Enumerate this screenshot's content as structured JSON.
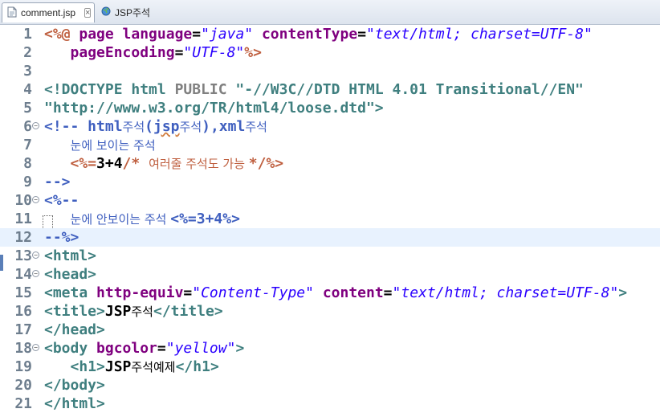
{
  "tabs": [
    {
      "label": "comment.jsp",
      "active": true,
      "icon": "jsp-file-icon"
    },
    {
      "label": "JSP주석",
      "active": false,
      "icon": "globe-icon"
    }
  ],
  "editor": {
    "current_line": 12,
    "lines": [
      {
        "n": "1",
        "tokens": [
          [
            "jsp",
            "<%@ "
          ],
          [
            "at",
            "page "
          ],
          [
            "at",
            "language"
          ],
          [
            "txt",
            "="
          ],
          [
            "str",
            "\"java\""
          ],
          [
            "txt",
            " "
          ],
          [
            "at",
            "contentType"
          ],
          [
            "txt",
            "="
          ],
          [
            "str",
            "\"text/html; charset=UTF-8\""
          ]
        ]
      },
      {
        "n": "2",
        "tokens": [
          [
            "txt",
            "   "
          ],
          [
            "at",
            "pageEncoding"
          ],
          [
            "txt",
            "="
          ],
          [
            "str",
            "\"UTF-8\""
          ],
          [
            "jsp",
            "%>"
          ]
        ]
      },
      {
        "n": "3",
        "tokens": []
      },
      {
        "n": "4",
        "tokens": [
          [
            "kw",
            "<!DOCTYPE html "
          ],
          [
            "gray",
            "PUBLIC "
          ],
          [
            "kw",
            "\"-//W3C//DTD HTML 4.01 Transitional//EN\""
          ]
        ]
      },
      {
        "n": "5",
        "tokens": [
          [
            "kw",
            "\"http://www.w3.org/TR/html4/loose.dtd\">"
          ]
        ]
      },
      {
        "n": "6",
        "fold": true,
        "tokens": [
          [
            "cm",
            "<!-- html"
          ],
          [
            "cmko",
            "주석"
          ],
          [
            "cm",
            "("
          ],
          [
            "cmsq",
            "jsp"
          ],
          [
            "cmko",
            "주석"
          ],
          [
            "cm",
            "),xml"
          ],
          [
            "cmko",
            "주석"
          ]
        ]
      },
      {
        "n": "7",
        "tokens": [
          [
            "cm",
            "   "
          ],
          [
            "cmko",
            "눈에 보이는 주석"
          ]
        ]
      },
      {
        "n": "8",
        "tokens": [
          [
            "txt",
            "   "
          ],
          [
            "jsp",
            "<%="
          ],
          [
            "txt",
            "3+4"
          ],
          [
            "jsp",
            "/* "
          ],
          [
            "jspko",
            "여러줄 주석도 가능 "
          ],
          [
            "jsp",
            "*/%>"
          ]
        ]
      },
      {
        "n": "9",
        "tokens": [
          [
            "cm",
            "-->"
          ]
        ]
      },
      {
        "n": "10",
        "fold": true,
        "tokens": [
          [
            "cm",
            "<%--"
          ]
        ]
      },
      {
        "n": "11",
        "tokens": [
          [
            "cm",
            "   "
          ],
          [
            "cmko",
            "눈에 안보이는 주석 "
          ],
          [
            "cm",
            "<%=3+4%>"
          ]
        ]
      },
      {
        "n": "12",
        "tokens": [
          [
            "cm",
            "--%>"
          ]
        ]
      },
      {
        "n": "13",
        "fold": true,
        "tokens": [
          [
            "kw",
            "<html>"
          ]
        ]
      },
      {
        "n": "14",
        "fold": true,
        "tokens": [
          [
            "kw",
            "<head>"
          ]
        ]
      },
      {
        "n": "15",
        "tokens": [
          [
            "kw",
            "<meta "
          ],
          [
            "at",
            "http-equiv"
          ],
          [
            "txt",
            "="
          ],
          [
            "str",
            "\"Content-Type\""
          ],
          [
            "txt",
            " "
          ],
          [
            "at",
            "content"
          ],
          [
            "txt",
            "="
          ],
          [
            "str",
            "\"text/html; charset=UTF-8\""
          ],
          [
            "kw",
            ">"
          ]
        ]
      },
      {
        "n": "16",
        "tokens": [
          [
            "kw",
            "<title>"
          ],
          [
            "txt",
            "JSP"
          ],
          [
            "txtko",
            "주석"
          ],
          [
            "kw",
            "</title>"
          ]
        ]
      },
      {
        "n": "17",
        "tokens": [
          [
            "kw",
            "</head>"
          ]
        ]
      },
      {
        "n": "18",
        "fold": true,
        "tokens": [
          [
            "kw",
            "<body "
          ],
          [
            "at",
            "bgcolor"
          ],
          [
            "txt",
            "="
          ],
          [
            "str",
            "\"yellow\""
          ],
          [
            "kw",
            ">"
          ]
        ]
      },
      {
        "n": "19",
        "tokens": [
          [
            "txt",
            "   "
          ],
          [
            "kw",
            "<h1>"
          ],
          [
            "txt",
            "JSP"
          ],
          [
            "txtko",
            "주석예제"
          ],
          [
            "kw",
            "</h1>"
          ]
        ]
      },
      {
        "n": "20",
        "tokens": [
          [
            "kw",
            "</body>"
          ]
        ]
      },
      {
        "n": "21",
        "tokens": [
          [
            "kw",
            "</html>"
          ]
        ]
      }
    ]
  },
  "colors": {
    "jsp_delim": "#bf5f3f",
    "tag": "#3f7f7f",
    "attr": "#7f007f",
    "string": "#2a00ff",
    "comment": "#3f5fbf",
    "current_line_bg": "#e8f2fe"
  }
}
